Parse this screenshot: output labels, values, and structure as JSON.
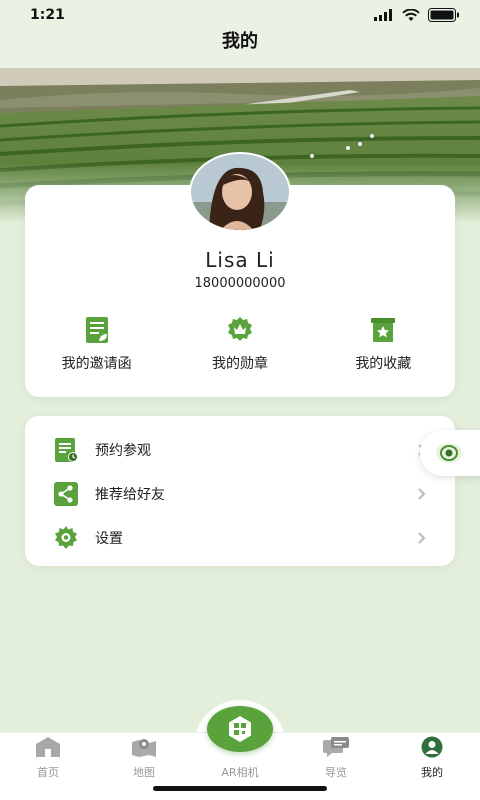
{
  "status_bar": {
    "time": "1:21"
  },
  "header": {
    "title": "我的"
  },
  "profile": {
    "name": "Lisa Li",
    "phone": "18000000000"
  },
  "quick_actions": [
    {
      "label": "我的邀请函",
      "icon": "invitation-icon"
    },
    {
      "label": "我的勋章",
      "icon": "medal-icon"
    },
    {
      "label": "我的收藏",
      "icon": "favorites-icon"
    }
  ],
  "menu": [
    {
      "label": "预约参观",
      "icon": "appointment-icon"
    },
    {
      "label": "推荐给好友",
      "icon": "share-icon"
    },
    {
      "label": "设置",
      "icon": "settings-icon"
    }
  ],
  "tabs": [
    {
      "label": "首页",
      "icon": "home-icon",
      "active": false
    },
    {
      "label": "地图",
      "icon": "map-icon",
      "active": false
    },
    {
      "label": "AR相机",
      "icon": "ar-camera-icon",
      "active": false
    },
    {
      "label": "导览",
      "icon": "guide-icon",
      "active": false
    },
    {
      "label": "我的",
      "icon": "profile-icon",
      "active": true
    }
  ],
  "colors": {
    "accent": "#5aa23c",
    "background": "#e3eedb",
    "card": "#ffffff"
  }
}
